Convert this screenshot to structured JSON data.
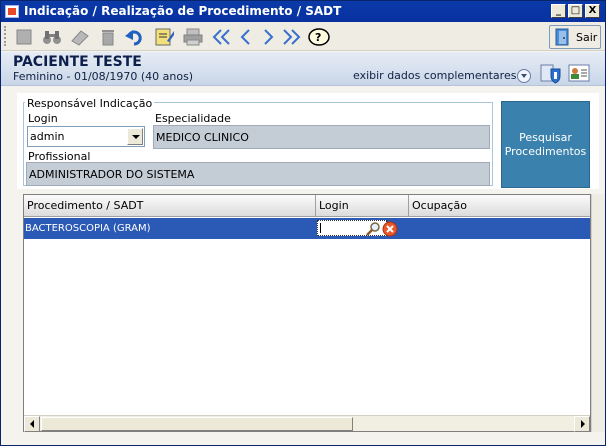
{
  "window": {
    "title": "Indicação / Realização de Procedimento / SADT"
  },
  "titlebar_buttons": {
    "minimize": "_",
    "maximize": "□",
    "close": "X"
  },
  "toolbar": {
    "items": [
      "new-icon",
      "binoculars-icon",
      "eraser-icon",
      "trash-icon",
      "undo-icon",
      "edit-icon",
      "print-icon",
      "first-icon",
      "previous-icon",
      "next-icon",
      "last-icon",
      "help-icon"
    ],
    "exit_label": "Sair"
  },
  "patient": {
    "name": "PACIENTE TESTE",
    "info": "Feminino - 01/08/1970 (40 anos)",
    "extra_link": "exibir dados complementares..."
  },
  "indication": {
    "legend": "Responsável Indicação",
    "login_label": "Login",
    "login_value": "admin",
    "specialty_label": "Especialidade",
    "specialty_value": "MEDICO CLINICO",
    "professional_label": "Profissional",
    "professional_value": "ADMINISTRADOR DO SISTEMA",
    "search_button": "Pesquisar Procedimentos"
  },
  "grid": {
    "columns": [
      "Procedimento / SADT",
      "Login",
      "Ocupação"
    ],
    "rows": [
      {
        "procedure": "BACTEROSCOPIA (GRAM)",
        "login": "",
        "occupation": ""
      }
    ]
  },
  "colors": {
    "titlebar": "#0a3aa8",
    "selected_row": "#2a5ab5",
    "search_button": "#3a82ad"
  }
}
